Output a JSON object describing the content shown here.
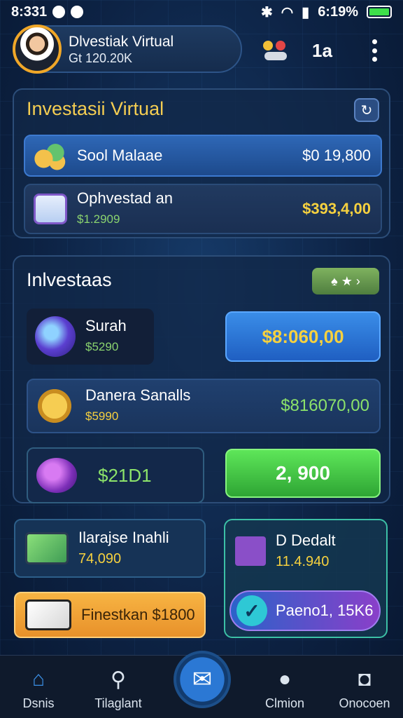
{
  "status_bar": {
    "time": "8:331",
    "battery": "6:19%"
  },
  "header": {
    "name": "Dlvestiak Virtual",
    "subtitle": "Gt 120.20K"
  },
  "top_bar": {
    "count": "1a"
  },
  "virtual_panel": {
    "title": "Investasii Virtual",
    "row1": {
      "label": "Sool Malaae",
      "value": "$0 19,800"
    },
    "row2": {
      "label": "Ophvestad an",
      "sub": "$1.2909",
      "value": "$393,4,00"
    }
  },
  "invest_panel": {
    "title": "Inlvestaas",
    "item1": {
      "name": "Surah",
      "sub": "$5290",
      "value": "$8:060,00"
    },
    "item2": {
      "name": "Danera Sanalls",
      "sub": "$5990",
      "value": "$816070,00"
    },
    "item3": {
      "value": "$21D1",
      "action": "2, 900"
    }
  },
  "cards": {
    "card1": {
      "title": "Ilarajse Inahli",
      "value": "74,090"
    },
    "card2": {
      "title": "D Dedalt",
      "value": "11.4.940",
      "pill": "Paeno1, 15K6"
    },
    "card3": {
      "label": "Finestkan $1800"
    }
  },
  "nav": {
    "home": "Dsnis",
    "search": "Tilaglant",
    "chat": "Clmion",
    "profile": "Onocoen"
  },
  "colors": {
    "accent": "#2b78d4",
    "gold": "#f6d13f",
    "green": "#8ce36a"
  }
}
